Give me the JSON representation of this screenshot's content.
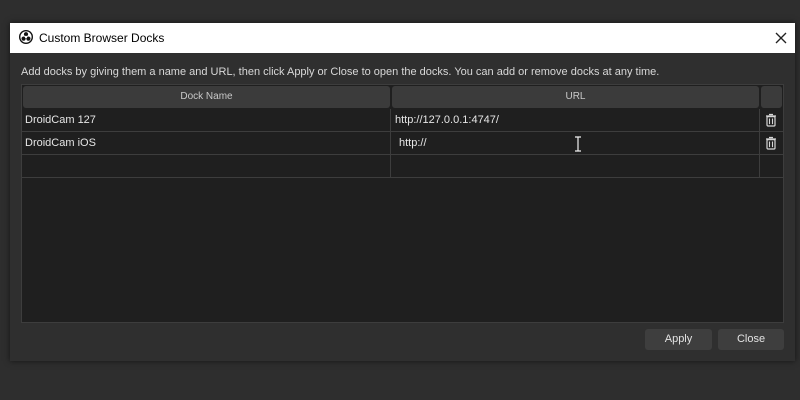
{
  "window": {
    "title": "Custom Browser Docks",
    "icon": "obs-logo-icon",
    "close_icon": "close-icon"
  },
  "instructions": "Add docks by giving them a name and URL, then click Apply or Close to open the docks. You can add or remove docks at any time.",
  "table": {
    "columns": [
      "Dock Name",
      "URL",
      ""
    ],
    "rows": [
      {
        "name": "DroidCam 127",
        "url": "http://127.0.0.1:4747/",
        "action_icon": "trash-icon"
      },
      {
        "name": "DroidCam iOS",
        "url": "http://",
        "action_icon": "trash-icon",
        "editing": true
      },
      {
        "name": "",
        "url": ""
      }
    ]
  },
  "buttons": {
    "apply": "Apply",
    "close": "Close"
  },
  "colors": {
    "dialog_bg": "#2f2f2f",
    "table_bg": "#1f1f1f",
    "header_bg": "#3b3b3b",
    "button_bg": "#3e3e3e",
    "titlebar_bg": "#ffffff"
  }
}
